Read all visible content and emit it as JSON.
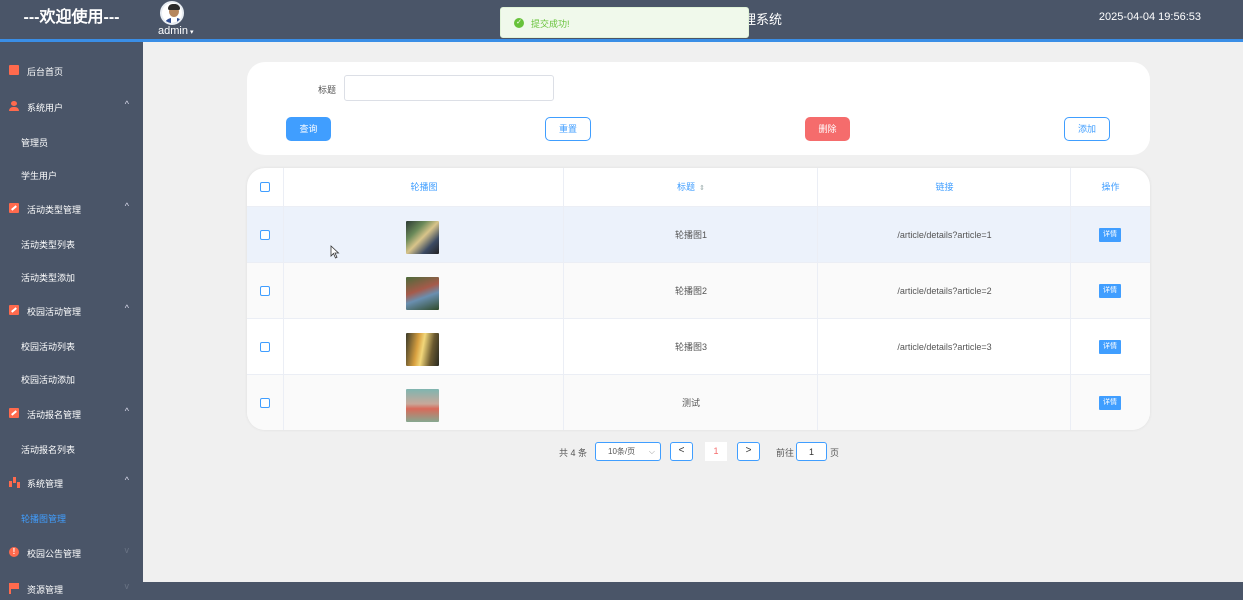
{
  "header": {
    "welcome": "---欢迎使用---",
    "username": "admin",
    "username_caret": "▾",
    "system_title": "理系统",
    "datetime": "2025-04-04 19:56:53",
    "accent_color": "#3a8ee6"
  },
  "toast": {
    "icon": "check-circle-icon",
    "icon_glyph": "✓",
    "message": "提交成功!"
  },
  "sidebar": {
    "items": [
      {
        "label": "后台首页",
        "icon": "monitor-icon"
      },
      {
        "label": "系统用户",
        "icon": "user-icon",
        "caret": "^"
      },
      {
        "label": "管理员"
      },
      {
        "label": "学生用户"
      },
      {
        "label": "活动类型管理",
        "icon": "edit-icon",
        "caret": "^"
      },
      {
        "label": "活动类型列表"
      },
      {
        "label": "活动类型添加"
      },
      {
        "label": "校园活动管理",
        "icon": "edit-icon",
        "caret": "^"
      },
      {
        "label": "校园活动列表"
      },
      {
        "label": "校园活动添加"
      },
      {
        "label": "活动报名管理",
        "icon": "edit-icon",
        "caret": "^"
      },
      {
        "label": "活动报名列表"
      },
      {
        "label": "系统管理",
        "icon": "chart-icon",
        "caret": "^"
      },
      {
        "label": "轮播图管理",
        "active": true
      },
      {
        "label": "校园公告管理",
        "icon": "alert-icon",
        "icon_glyph": "!",
        "caret": "v"
      },
      {
        "label": "资源管理",
        "icon": "flag-icon",
        "caret": "v"
      }
    ]
  },
  "search": {
    "title_label": "标题",
    "title_value": "",
    "title_placeholder": "",
    "query_label": "查询",
    "reset_label": "重置",
    "delete_label": "删除",
    "add_label": "添加"
  },
  "table": {
    "columns": [
      "轮播图",
      "标题",
      "链接",
      "操作"
    ],
    "sort_glyph": "⇕",
    "rows": [
      {
        "title": "轮播图1",
        "link": "/article/details?article=1",
        "action": "详情"
      },
      {
        "title": "轮播图2",
        "link": "/article/details?article=2",
        "action": "详情"
      },
      {
        "title": "轮播图3",
        "link": "/article/details?article=3",
        "action": "详情"
      },
      {
        "title": "测试",
        "link": "",
        "action": "详情"
      }
    ]
  },
  "pagination": {
    "total": "共 4 条",
    "page_size": "10条/页",
    "page_size_caret": "⌵",
    "prev": "<",
    "next": ">",
    "current_page": "1",
    "goto_label": "前往",
    "goto_value": "1",
    "page_suffix": "页"
  }
}
